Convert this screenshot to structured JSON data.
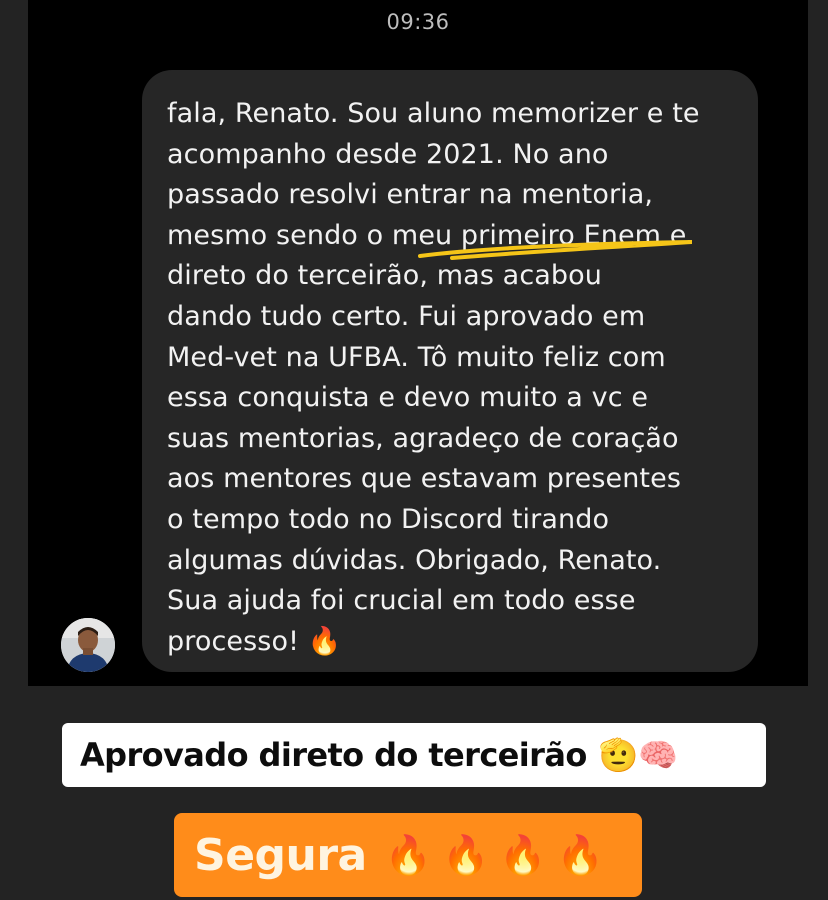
{
  "chat": {
    "timestamp": "09:36",
    "message_lines": [
      "fala, Renato. Sou aluno memorizer e te",
      "acompanho desde 2021. No ano",
      "passado resolvi entrar na mentoria,",
      "mesmo sendo o meu primeiro Enem e",
      "direto do terceirão, mas acabou",
      "dando tudo certo. Fui aprovado em",
      "Med-vet na UFBA. Tô muito feliz com",
      "essa conquista e devo muito a vc e",
      "suas mentorias, agradeço de coração",
      "aos mentores que estavam presentes",
      "o tempo todo no Discord tirando",
      "algumas dúvidas. Obrigado, Renato.",
      "Sua ajuda foi crucial em todo esse",
      "processo! 🔥"
    ],
    "highlight_color": "#f5c518",
    "avatar_icon": "profile-photo"
  },
  "caption": {
    "text": "Aprovado direto do terceirão",
    "emoji": "🫡🧠"
  },
  "segura": {
    "text": "Segura",
    "emoji": "🔥🔥🔥🔥",
    "color": "#ff8c1a"
  }
}
